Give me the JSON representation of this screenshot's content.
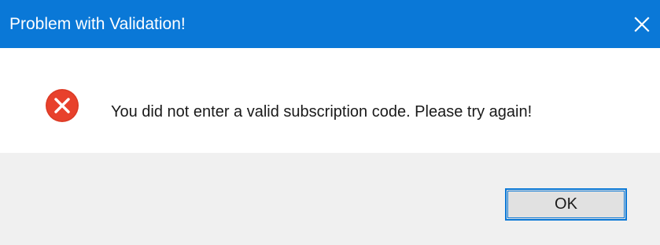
{
  "window": {
    "title": "Problem with Validation!",
    "close_icon": "close-icon",
    "titlebar_color": "#0a78d7"
  },
  "content": {
    "icon": "error-icon",
    "icon_color": "#e8412c",
    "message": "You did not enter a valid subscription code.  Please try again!"
  },
  "footer": {
    "ok_label": "OK",
    "background_color": "#f0f0f0"
  }
}
